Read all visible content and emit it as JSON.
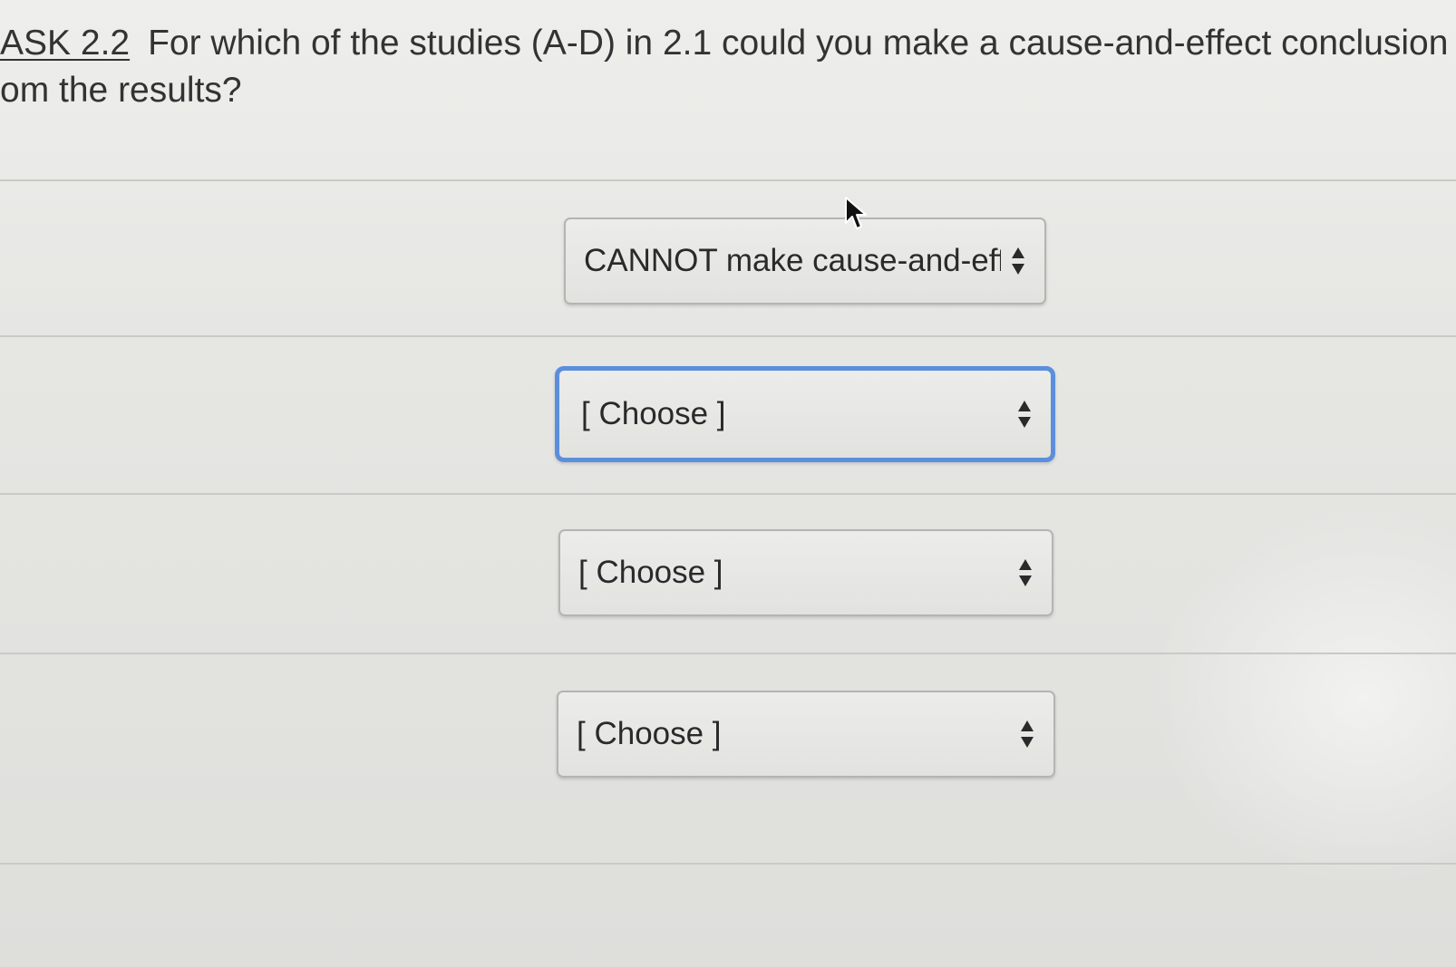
{
  "question": {
    "task_ref": "ASK 2.2",
    "line1": "For which of the studies (A-D) in 2.1 could you make a cause-and-effect conclusion",
    "line2": "om the results?"
  },
  "selects": [
    {
      "value": "CANNOT make cause-and-effe",
      "icon": "sort-arrows-icon"
    },
    {
      "value": "[ Choose ]",
      "icon": "sort-arrows-icon",
      "focused": true
    },
    {
      "value": "[ Choose ]",
      "icon": "sort-arrows-icon"
    },
    {
      "value": "[ Choose ]",
      "icon": "sort-arrows-icon"
    }
  ],
  "colors": {
    "focus_ring": "#5b8fdc",
    "background": "#e6e6e3",
    "text": "#2d2d2d"
  }
}
